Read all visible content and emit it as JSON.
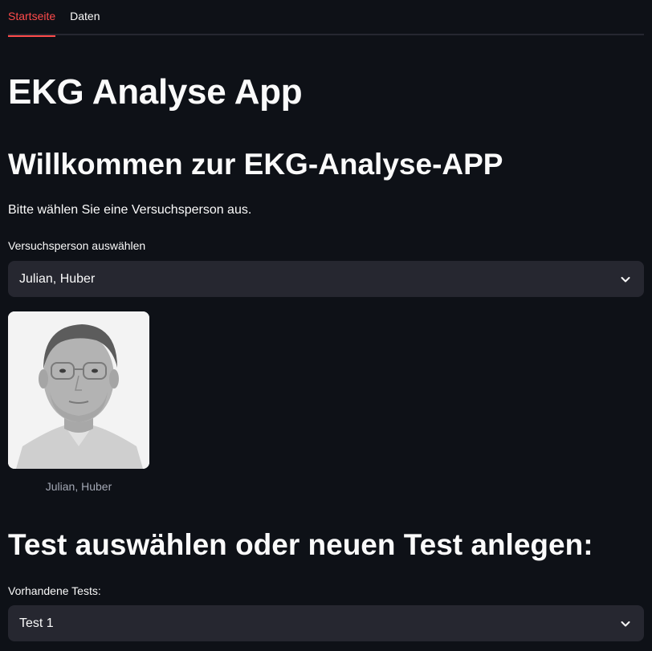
{
  "tabs": [
    {
      "label": "Startseite",
      "active": true
    },
    {
      "label": "Daten",
      "active": false
    }
  ],
  "main": {
    "app_title": "EKG Analyse App",
    "welcome_heading": "Willkommen zur EKG-Analyse-APP",
    "instruction": "Bitte wählen Sie eine Versuchsperson aus.",
    "person_select": {
      "label": "Versuchsperson auswählen",
      "selected": "Julian, Huber"
    },
    "photo_caption": "Julian, Huber",
    "test_heading": "Test auswählen oder neuen Test anlegen:",
    "test_select": {
      "label": "Vorhandene Tests:",
      "selected": "Test 1"
    }
  },
  "colors": {
    "background": "#0e1117",
    "accent": "#ff4b4b",
    "input_bg": "#262730",
    "caption": "#a3a8b4"
  }
}
